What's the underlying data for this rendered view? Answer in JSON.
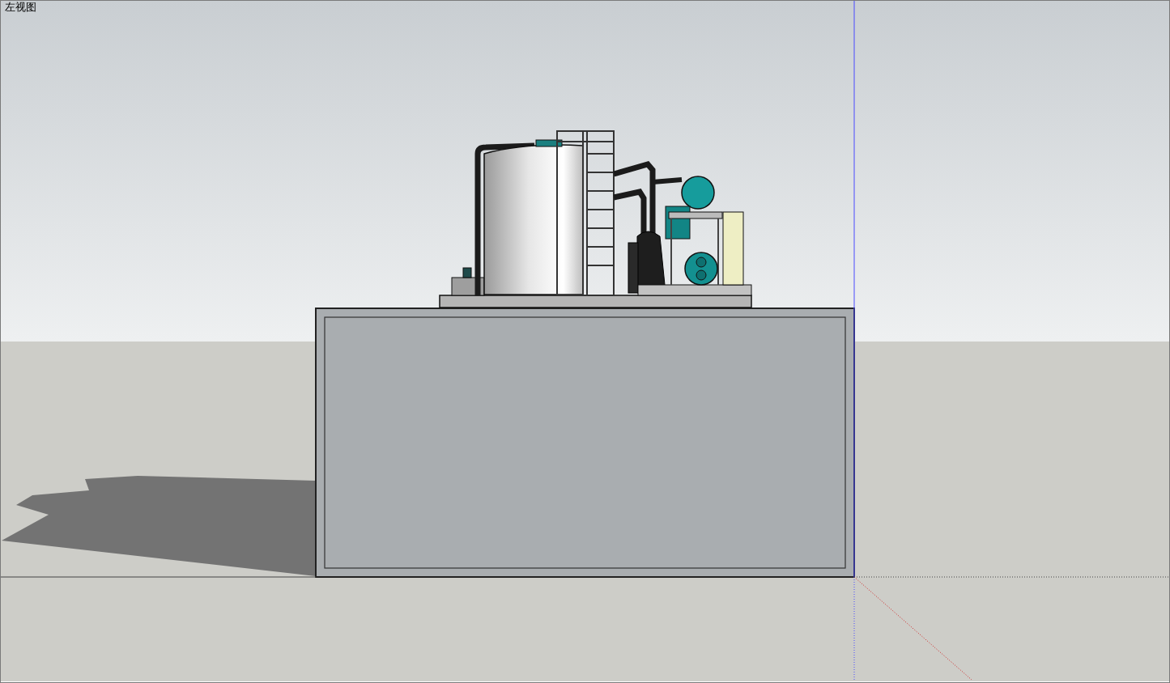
{
  "viewport": {
    "view_label": "左视图"
  }
}
